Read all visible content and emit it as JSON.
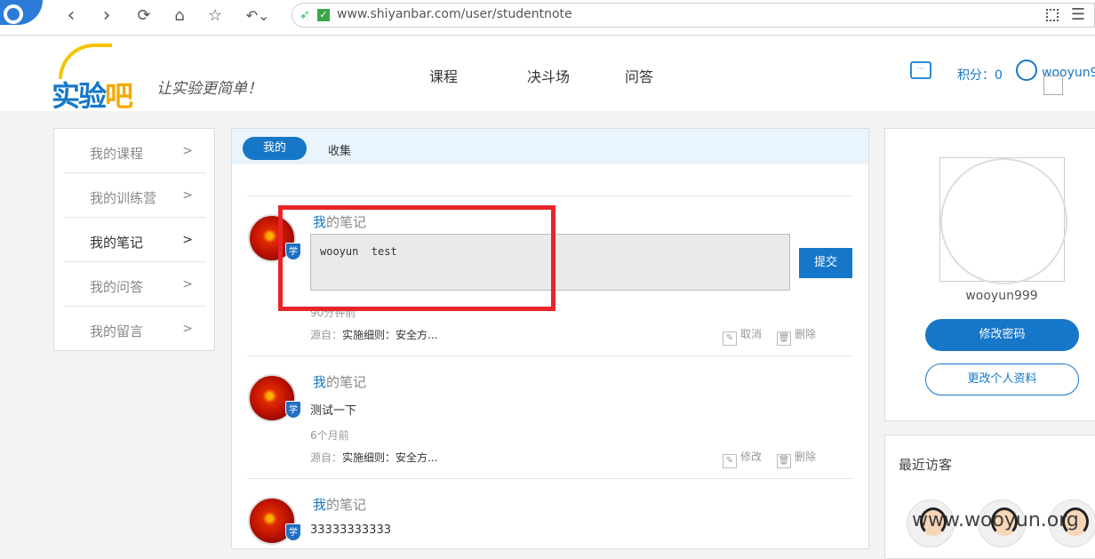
{
  "browser": {
    "url_host": "www.shiyanbar.com",
    "url_path": "/user/studentnote"
  },
  "header": {
    "logo_text_a": "实验",
    "logo_text_b": "吧",
    "slogan": "让实验更简单！",
    "nav": [
      "课程",
      "决斗场",
      "问答"
    ],
    "score_label": "积分：0",
    "username": "wooyun9"
  },
  "sidebar": {
    "items": [
      {
        "label": "我的课程",
        "arrow": ">"
      },
      {
        "label": "我的训练营",
        "arrow": ">"
      },
      {
        "label": "我的笔记",
        "arrow": ">"
      },
      {
        "label": "我的问答",
        "arrow": ">"
      },
      {
        "label": "我的留言",
        "arrow": ">"
      }
    ]
  },
  "tabs": {
    "mine": "我的",
    "favorites": "收集"
  },
  "notes": [
    {
      "title_me": "我",
      "title_rest": "的笔记",
      "edit_value": "wooyun  test",
      "submit": "提交",
      "time": "90分钟前",
      "source_label": "源自：",
      "source_value": "实施细则：安全方...",
      "action1": "取消",
      "action2": "删除"
    },
    {
      "title_me": "我",
      "title_rest": "的笔记",
      "text": "测试一下",
      "time": "6个月前",
      "source_label": "源自：",
      "source_value": "实施细则：安全方...",
      "action1": "修改",
      "action2": "删除"
    },
    {
      "title_me": "我",
      "title_rest": "的笔记",
      "text": "33333333333"
    }
  ],
  "badge_label": "学",
  "profile": {
    "name": "wooyun999",
    "change_password": "修改密码",
    "edit_profile": "更改个人资料"
  },
  "visitors": {
    "title": "最近访客"
  },
  "watermark": "www.wooyun.org"
}
